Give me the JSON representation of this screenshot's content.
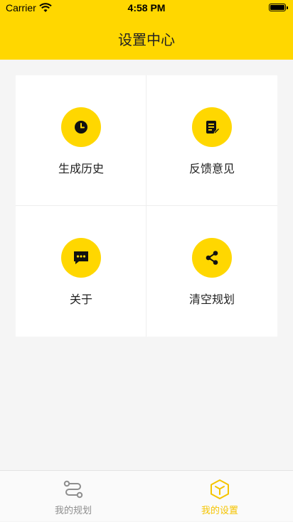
{
  "status_bar": {
    "carrier": "Carrier",
    "time": "4:58 PM"
  },
  "header": {
    "title": "设置中心"
  },
  "menu": [
    {
      "label": "生成历史",
      "icon": "clock-icon"
    },
    {
      "label": "反馈意见",
      "icon": "note-edit-icon"
    },
    {
      "label": "关于",
      "icon": "chat-dots-icon"
    },
    {
      "label": "清空规划",
      "icon": "share-icon"
    }
  ],
  "tabbar": {
    "items": [
      {
        "label": "我的规划",
        "icon": "route-icon",
        "active": false
      },
      {
        "label": "我的设置",
        "icon": "cube-icon",
        "active": true
      }
    ]
  },
  "colors": {
    "accent": "#ffd700",
    "active_tab": "#f5c400",
    "inactive_tab": "#8e8e8e"
  }
}
